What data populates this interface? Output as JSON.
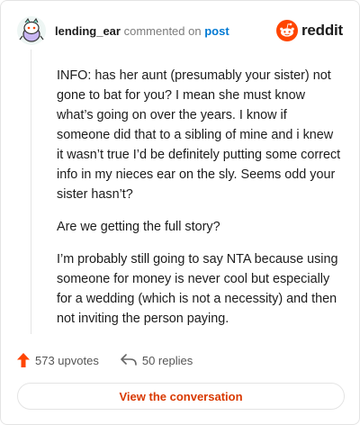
{
  "header": {
    "username": "lending_ear",
    "commented_text": "commented on",
    "post_link": "post",
    "brand": "reddit"
  },
  "comment": {
    "paragraphs": [
      "INFO: has her aunt (presumably your sister) not gone to bat for you? I mean she must know what’s going on over the years. I know if someone did that to a sibling of mine and i knew it wasn’t true I’d be definitely putting some correct info in my nieces ear on the sly. Seems odd your sister hasn’t?",
      "Are we getting the full story?",
      "I’m probably still going to say NTA because using someone for money is never cool but especially for a wedding (which is not a necessity) and then not inviting the person paying."
    ]
  },
  "actions": {
    "upvotes": "573 upvotes",
    "replies": "50 replies"
  },
  "cta": {
    "label": "View the conversation"
  },
  "colors": {
    "brand_orange": "#ff4500",
    "link_blue": "#0079d3",
    "cta_text": "#d93900"
  },
  "icons": {
    "avatar": "snoo-avatar-icon",
    "brand": "reddit-logo-icon",
    "upvote": "upvote-arrow-icon",
    "reply": "reply-arrow-icon"
  }
}
